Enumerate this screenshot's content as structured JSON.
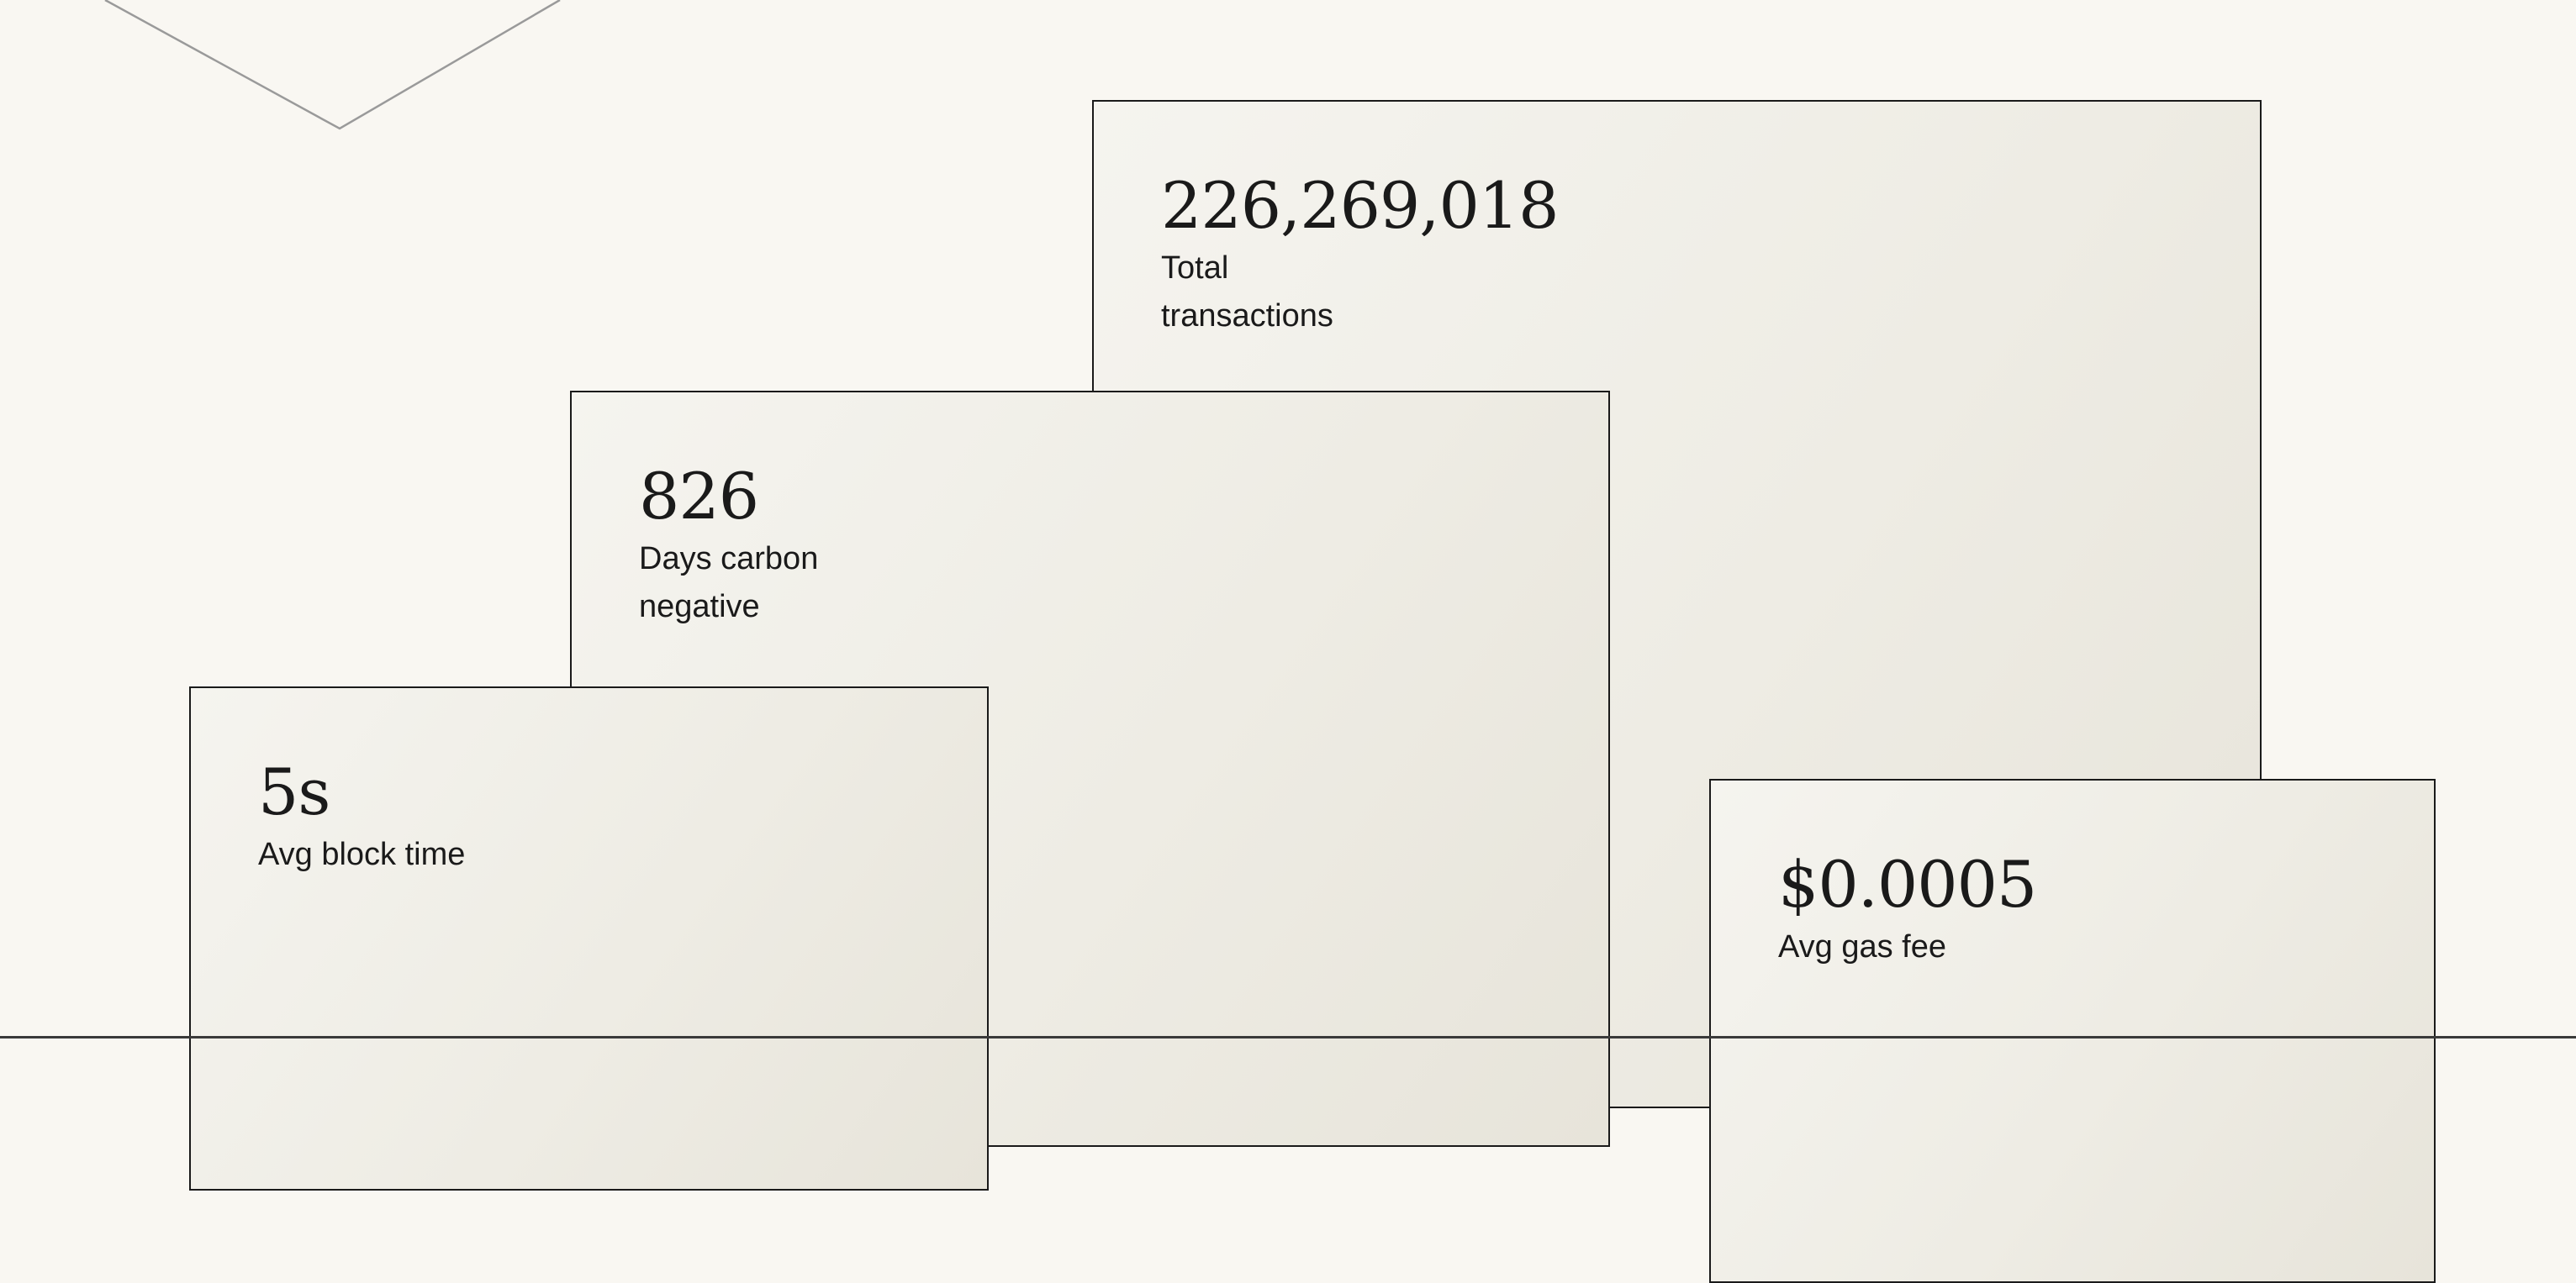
{
  "stats": {
    "transactions": {
      "value": "226,269,018",
      "label": "Total transactions"
    },
    "carbon": {
      "value": "826",
      "label": "Days carbon negative"
    },
    "block_time": {
      "value": "5s",
      "label": "Avg block time"
    },
    "gas_fee": {
      "value": "$0.0005",
      "label": "Avg gas fee"
    }
  },
  "colors": {
    "background": "#f9f7f2",
    "card_border": "#1a1a1a",
    "text": "#1a1a1a",
    "decor_line": "#9a9a9a"
  }
}
